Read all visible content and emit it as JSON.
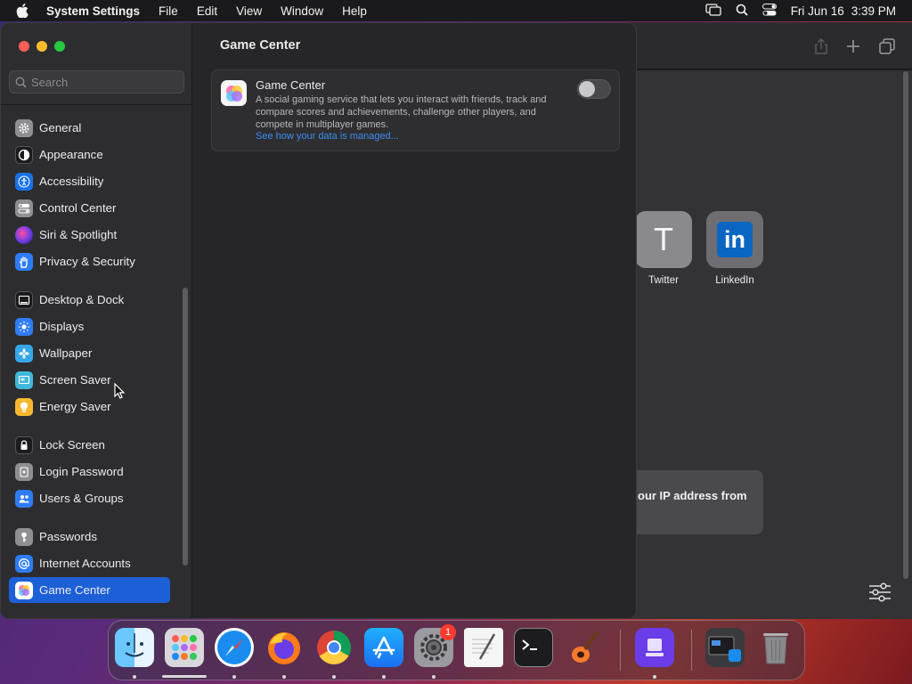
{
  "menubar": {
    "app": "System Settings",
    "items": [
      "File",
      "Edit",
      "View",
      "Window",
      "Help"
    ],
    "date": "Fri Jun 16",
    "time": "3:39 PM"
  },
  "sidebar": {
    "search_placeholder": "Search",
    "items": [
      {
        "label": "General",
        "icon": "gear-icon",
        "color": "#8e8e93"
      },
      {
        "label": "Appearance",
        "icon": "appearance-icon",
        "color": "#1c1c1e"
      },
      {
        "label": "Accessibility",
        "icon": "accessibility-icon",
        "color": "#1a73e8"
      },
      {
        "label": "Control Center",
        "icon": "control-center-icon",
        "color": "#8e8e93"
      },
      {
        "label": "Siri & Spotlight",
        "icon": "siri-icon",
        "color": "#6a3de8"
      },
      {
        "label": "Privacy & Security",
        "icon": "hand-icon",
        "color": "#2f7cf6"
      },
      {
        "label": "Desktop & Dock",
        "icon": "dock-icon",
        "color": "#1c1c1e"
      },
      {
        "label": "Displays",
        "icon": "displays-icon",
        "color": "#2f7cf6"
      },
      {
        "label": "Wallpaper",
        "icon": "wallpaper-icon",
        "color": "#35a7e8"
      },
      {
        "label": "Screen Saver",
        "icon": "screen-saver-icon",
        "color": "#40b8d8"
      },
      {
        "label": "Energy Saver",
        "icon": "energy-icon",
        "color": "#f5b82e"
      },
      {
        "label": "Lock Screen",
        "icon": "lock-icon",
        "color": "#1c1c1e"
      },
      {
        "label": "Login Password",
        "icon": "password-icon",
        "color": "#8e8e93"
      },
      {
        "label": "Users & Groups",
        "icon": "users-icon",
        "color": "#2f7cf6"
      },
      {
        "label": "Passwords",
        "icon": "key-icon",
        "color": "#8e8e93"
      },
      {
        "label": "Internet Accounts",
        "icon": "at-icon",
        "color": "#2f7cf6"
      },
      {
        "label": "Game Center",
        "icon": "game-center-icon",
        "color": "#ffffff"
      }
    ],
    "selected": "Game Center"
  },
  "main": {
    "title": "Game Center",
    "card": {
      "title": "Game Center",
      "description": "A social gaming service that lets you interact with friends, track and compare scores and achievements, challenge other players, and compete in multiplayer games.",
      "link": "See how your data is managed...",
      "toggle_on": false
    }
  },
  "background_window": {
    "tiles": [
      {
        "label": "Twitter",
        "glyph": "T"
      },
      {
        "label": "LinkedIn",
        "glyph": "in"
      }
    ],
    "notice": "our IP address from"
  },
  "dock": {
    "apps": [
      "Finder",
      "Launchpad",
      "Safari",
      "Firefox",
      "Chrome",
      "App Store",
      "System Settings",
      "TextEdit",
      "Terminal",
      "GarageBand",
      "Apple Configurator",
      "Downloads",
      "Trash"
    ],
    "settings_badge": "1"
  },
  "colors": {
    "accent": "#1d5fd6",
    "link": "#3d8ef0"
  }
}
